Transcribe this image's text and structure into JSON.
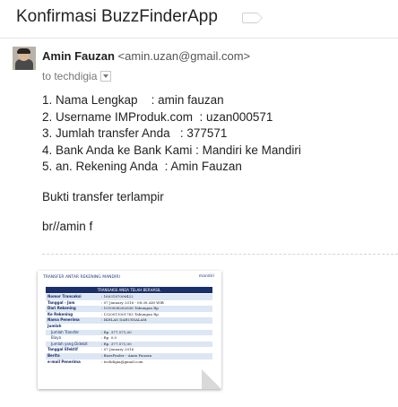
{
  "email": {
    "subject": "Konfirmasi BuzzFinderApp",
    "sender_name": "Amin Fauzan",
    "sender_email": "<amin.uzan@gmail.com>",
    "to_line": "to techdigia",
    "body_lines": [
      "1. Nama Lengkap    : amin fauzan",
      "2. Username IMProduk.com  : uzan000571",
      "3. Jumlah transfer Anda   : 377571",
      "4. Bank Anda ke Bank Kami : Mandiri ke Mandiri",
      "5. an. Rekening Anda  : Amin Fauzan"
    ],
    "attachment_note": "Bukti transfer terlampir",
    "signature": "br//amin f"
  },
  "attachment": {
    "doc_title": "TRANSFER ANTAR REKENING MANDIRI",
    "logo_text": "mandiri",
    "header": "TRANSAKSI ANDA TELAH BERHASIL",
    "rows": [
      {
        "k": "Nomor Transaksi",
        "v": ": 1603187006422",
        "sub": false
      },
      {
        "k": "Tanggal - Jam",
        "v": ": 07 January 2016 - 08:38 AM WIB",
        "sub": false
      },
      {
        "k": "Dari Rekening",
        "v": ": 1010006262636 Tabungan Rp",
        "sub": false
      },
      {
        "k": "Ke Rekening",
        "v": ": 1320011001763 Tabungan Rp",
        "sub": false
      },
      {
        "k": "Nama Penerima",
        "v": ": IKHLAS DARUSSALAM",
        "sub": false
      },
      {
        "k": "Jumlah",
        "v": "",
        "sub": false
      },
      {
        "k": "Jumlah Transfer",
        "v": ": Rp. 377.571,00",
        "sub": true
      },
      {
        "k": "Biaya",
        "v": ": Rp. 0,0",
        "sub": true
      },
      {
        "k": "Jumlah yang Didebit",
        "v": ": Rp. 377.571,00",
        "sub": true
      },
      {
        "k": "Tanggal Efektif",
        "v": ": 07 January 2016",
        "sub": false
      },
      {
        "k": "Berita",
        "v": ": BuzzFinder - Amin Fauzan",
        "sub": false
      },
      {
        "k": "e-mail Penerima",
        "v": ": techdigia@gmail.com",
        "sub": false
      }
    ]
  }
}
